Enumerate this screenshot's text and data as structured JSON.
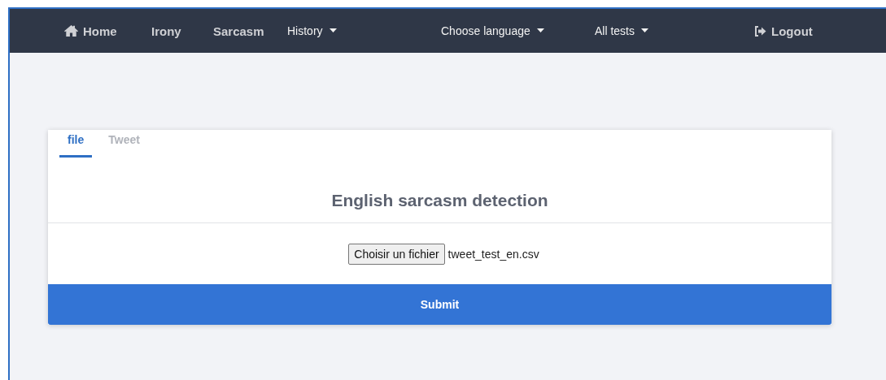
{
  "navbar": {
    "items": [
      {
        "kind": "home",
        "label": "Home"
      },
      {
        "kind": "link",
        "label": "Irony"
      },
      {
        "kind": "link",
        "label": "Sarcasm"
      },
      {
        "kind": "dropdown",
        "label": "History"
      },
      {
        "kind": "dropdown",
        "label": "Choose language"
      },
      {
        "kind": "dropdown",
        "label": "All tests"
      },
      {
        "kind": "logout",
        "label": "Logout"
      }
    ]
  },
  "card": {
    "tabs": [
      {
        "label": "file",
        "selected": true
      },
      {
        "label": "Tweet",
        "selected": false
      }
    ],
    "title": "English sarcasm detection",
    "file_input": {
      "button": "Choisir un fichier",
      "value": "tweet_test_en.csv"
    },
    "submit": "Submit"
  }
}
